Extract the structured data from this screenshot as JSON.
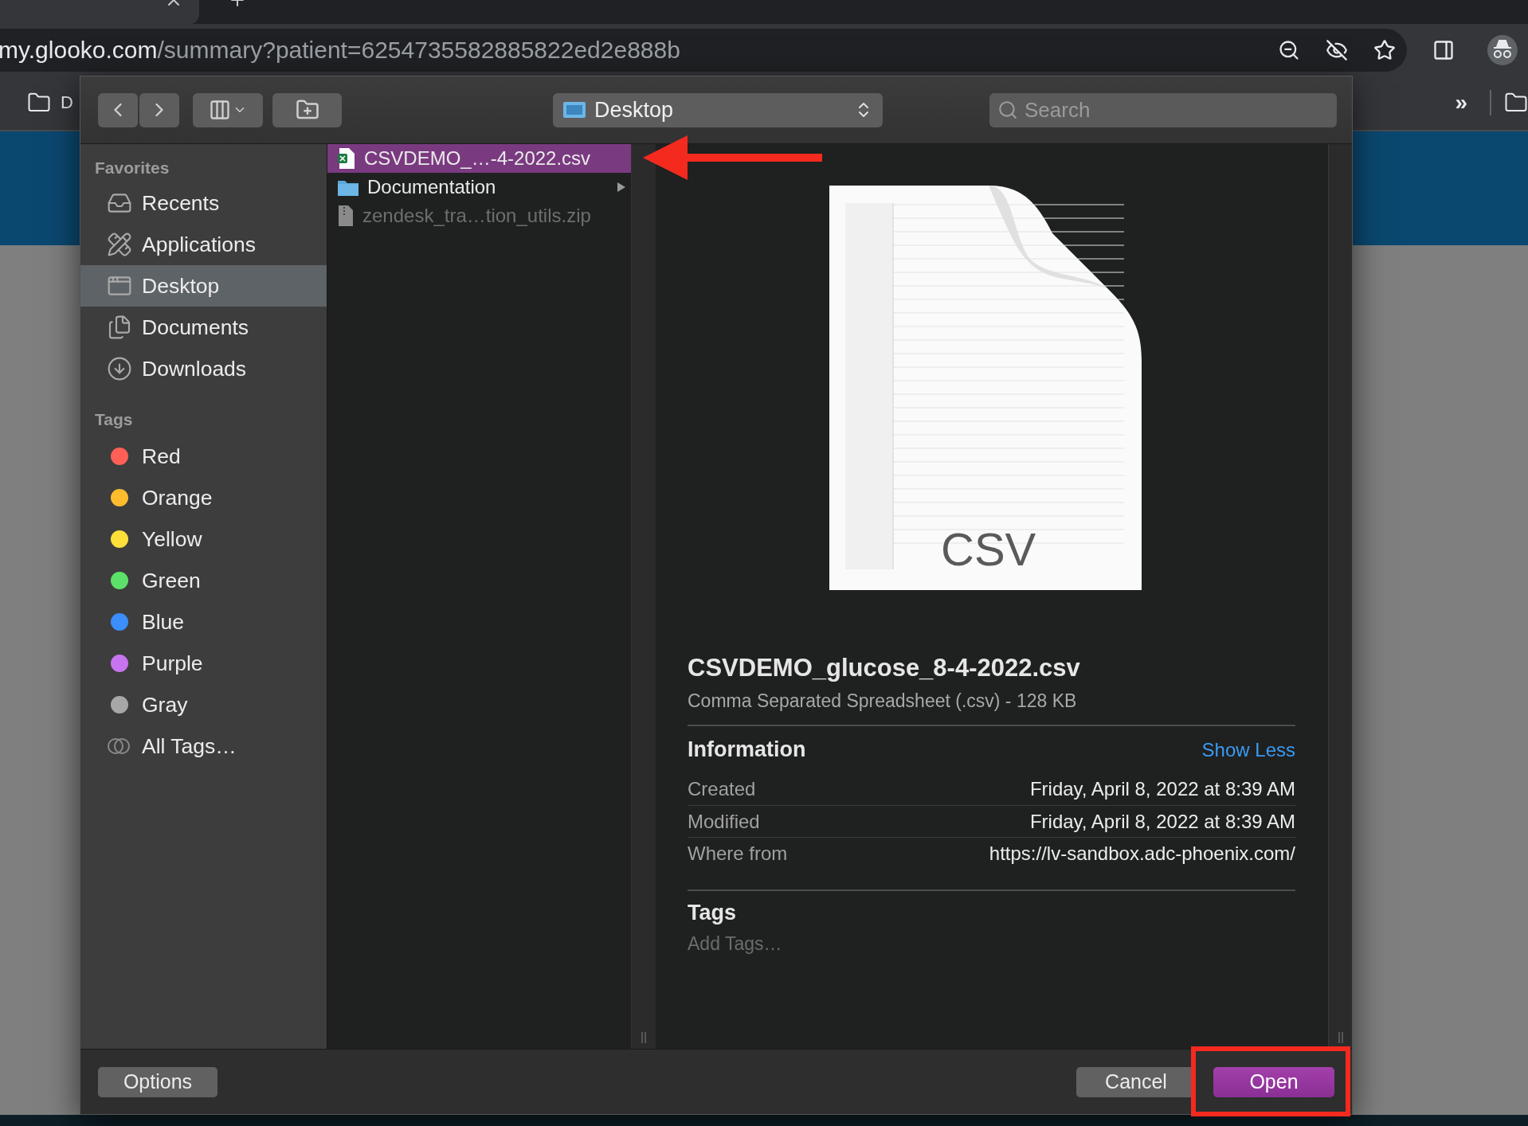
{
  "browser": {
    "url": {
      "host": "my.glooko.com",
      "path": "/summary?patient=6254735582885822ed2e888b"
    },
    "bookmarks": {
      "left_label": "D",
      "overflow": "»"
    }
  },
  "dialog": {
    "toolbar": {
      "location": "Desktop",
      "search": {
        "placeholder": "Search"
      }
    },
    "sidebar": {
      "sections": [
        {
          "title": "Favorites",
          "items": [
            {
              "label": "Recents",
              "kind": "recents",
              "selected": false
            },
            {
              "label": "Applications",
              "kind": "applications",
              "selected": false
            },
            {
              "label": "Desktop",
              "kind": "desktop",
              "selected": true
            },
            {
              "label": "Documents",
              "kind": "documents",
              "selected": false
            },
            {
              "label": "Downloads",
              "kind": "downloads",
              "selected": false
            }
          ]
        },
        {
          "title": "Tags",
          "items": [
            {
              "label": "Red",
              "kind": "tag",
              "color": "#ff5f57",
              "selected": false
            },
            {
              "label": "Orange",
              "kind": "tag",
              "color": "#febc2e",
              "selected": false
            },
            {
              "label": "Yellow",
              "kind": "tag",
              "color": "#fedf3a",
              "selected": false
            },
            {
              "label": "Green",
              "kind": "tag",
              "color": "#5ce26a",
              "selected": false
            },
            {
              "label": "Blue",
              "kind": "tag",
              "color": "#3b8efb",
              "selected": false
            },
            {
              "label": "Purple",
              "kind": "tag",
              "color": "#c873f0",
              "selected": false
            },
            {
              "label": "Gray",
              "kind": "tag",
              "color": "#a7a7a7",
              "selected": false
            },
            {
              "label": "All Tags…",
              "kind": "all_tags",
              "selected": false
            }
          ]
        }
      ]
    },
    "files": [
      {
        "name": "CSVDEMO_…-4-2022.csv",
        "kind": "spreadsheet",
        "selected": true,
        "disabled": false
      },
      {
        "name": "Documentation",
        "kind": "folder",
        "selected": false,
        "disabled": false
      },
      {
        "name": "zendesk_tra…tion_utils.zip",
        "kind": "zip",
        "selected": false,
        "disabled": true
      }
    ],
    "preview": {
      "thumbnail_label": "CSV",
      "title": "CSVDEMO_glucose_8-4-2022.csv",
      "subtitle": "Comma Separated Spreadsheet (.csv) - 128 KB",
      "info_heading": "Information",
      "info_toggle": "Show Less",
      "info_rows": [
        {
          "label": "Created",
          "value": "Friday, April 8, 2022 at 8:39 AM"
        },
        {
          "label": "Modified",
          "value": "Friday, April 8, 2022 at 8:39 AM"
        },
        {
          "label": "Where from",
          "value": "https://lv-sandbox.adc-phoenix.com/"
        }
      ],
      "tags_heading": "Tags",
      "tags_field": {
        "placeholder": "Add Tags…"
      }
    },
    "left_buttons": [
      {
        "label": "Options",
        "kind": "default"
      }
    ],
    "right_buttons": [
      {
        "label": "Cancel",
        "kind": "default"
      },
      {
        "label": "Open",
        "kind": "primary"
      }
    ]
  }
}
